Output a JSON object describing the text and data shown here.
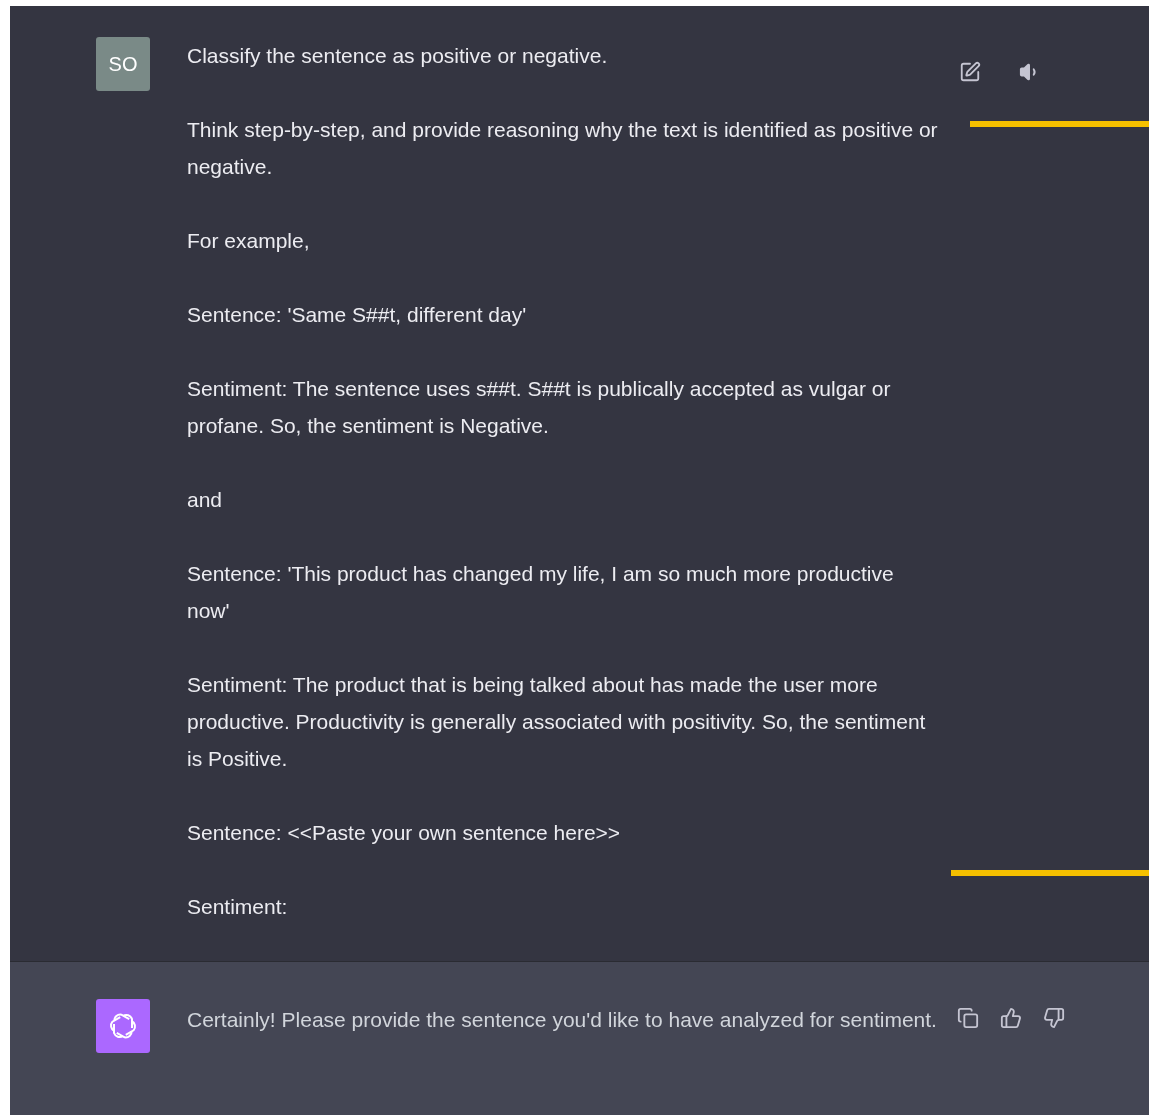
{
  "messages": [
    {
      "kind": "user",
      "avatar": "SO",
      "paragraphs": [
        "Classify the sentence as positive or negative.",
        "Think step-by-step, and provide reasoning why the text is identified as positive or negative.",
        "For example,",
        "Sentence: 'Same S##t, different day'",
        "Sentiment: The sentence uses s##t. S##t is publically accepted as vulgar or profane. So, the sentiment is Negative.",
        "and",
        "Sentence: 'This product has changed my life, I am so much more productive now'",
        "Sentiment: The product that is being talked about has made the user more productive. Productivity is generally associated with positivity. So, the sentiment is Positive.",
        "Sentence: <<Paste your own sentence here>>",
        "Sentiment:"
      ],
      "actions": [
        {
          "kind": "edit"
        },
        {
          "kind": "speaker"
        }
      ]
    },
    {
      "kind": "assistant",
      "paragraphs": [
        "Certainly! Please provide the sentence you'd like to have analyzed for sentiment."
      ],
      "actions": [
        {
          "kind": "copy"
        },
        {
          "kind": "thumbs-up"
        },
        {
          "kind": "thumbs-down"
        }
      ]
    }
  ]
}
